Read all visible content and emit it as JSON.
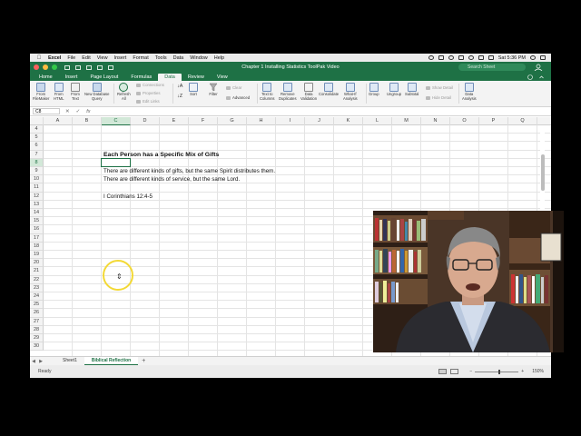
{
  "menubar": {
    "app": "Excel",
    "items": [
      "File",
      "Edit",
      "View",
      "Insert",
      "Format",
      "Tools",
      "Data",
      "Window",
      "Help"
    ],
    "clock": "Sat 5:36 PM"
  },
  "window": {
    "title": "Chapter 1 Installing Statistics ToolPak Video",
    "search_placeholder": "Search Sheet"
  },
  "ribbon_tabs": [
    "Home",
    "Insert",
    "Page Layout",
    "Formulas",
    "Data",
    "Review",
    "View"
  ],
  "active_tab": "Data",
  "ribbon": {
    "from_filemaker": "From\nFileMaker",
    "from_html": "From\nHTML",
    "from_text": "From\nText",
    "new_db_query": "New Database\nQuery",
    "refresh_all": "Refresh\nAll",
    "connections": "Connections",
    "properties": "Properties",
    "edit_links": "Edit Links",
    "sort": "Sort",
    "filter": "Filter",
    "clear": "Clear",
    "advanced": "Advanced",
    "text_to_columns": "Text to\nColumns",
    "remove_duplicates": "Remove\nDuplicates",
    "data_validation": "Data\nValidation",
    "consolidate": "Consolidate",
    "what_if": "What-If\nAnalysis",
    "group": "Group",
    "ungroup": "Ungroup",
    "subtotal": "Subtotal",
    "show_detail": "Show Detail",
    "hide_detail": "Hide Detail",
    "data_analysis": "Data\nAnalysis"
  },
  "formula_bar": {
    "name_box": "C8",
    "fx": "fx",
    "value": ""
  },
  "columns": [
    "A",
    "B",
    "C",
    "D",
    "E",
    "F",
    "G",
    "H",
    "I",
    "J",
    "K",
    "L",
    "M",
    "N",
    "O",
    "P",
    "Q"
  ],
  "selected_column": "C",
  "rows": [
    "4",
    "5",
    "6",
    "7",
    "8",
    "9",
    "10",
    "11",
    "12",
    "13",
    "14",
    "15",
    "16",
    "17",
    "18",
    "19",
    "20",
    "21",
    "22",
    "23",
    "24",
    "25",
    "26",
    "27",
    "28",
    "29",
    "30"
  ],
  "selected_row": "8",
  "cells": {
    "title": "Each Person has a Specific Mix of Gifts",
    "line1": "There are different kinds of gifts, but the same Spirit distributes them.",
    "line2": "There are different kinds of service, but the same Lord.",
    "reference": "I Corinthians 12:4-5"
  },
  "sheets": [
    "Sheet1",
    "Biblical Reflection"
  ],
  "active_sheet": "Biblical Reflection",
  "status": {
    "ready": "Ready",
    "zoom": "150%"
  },
  "colors": {
    "excel_green": "#1e7145",
    "cursor_highlight": "#f3d936"
  }
}
